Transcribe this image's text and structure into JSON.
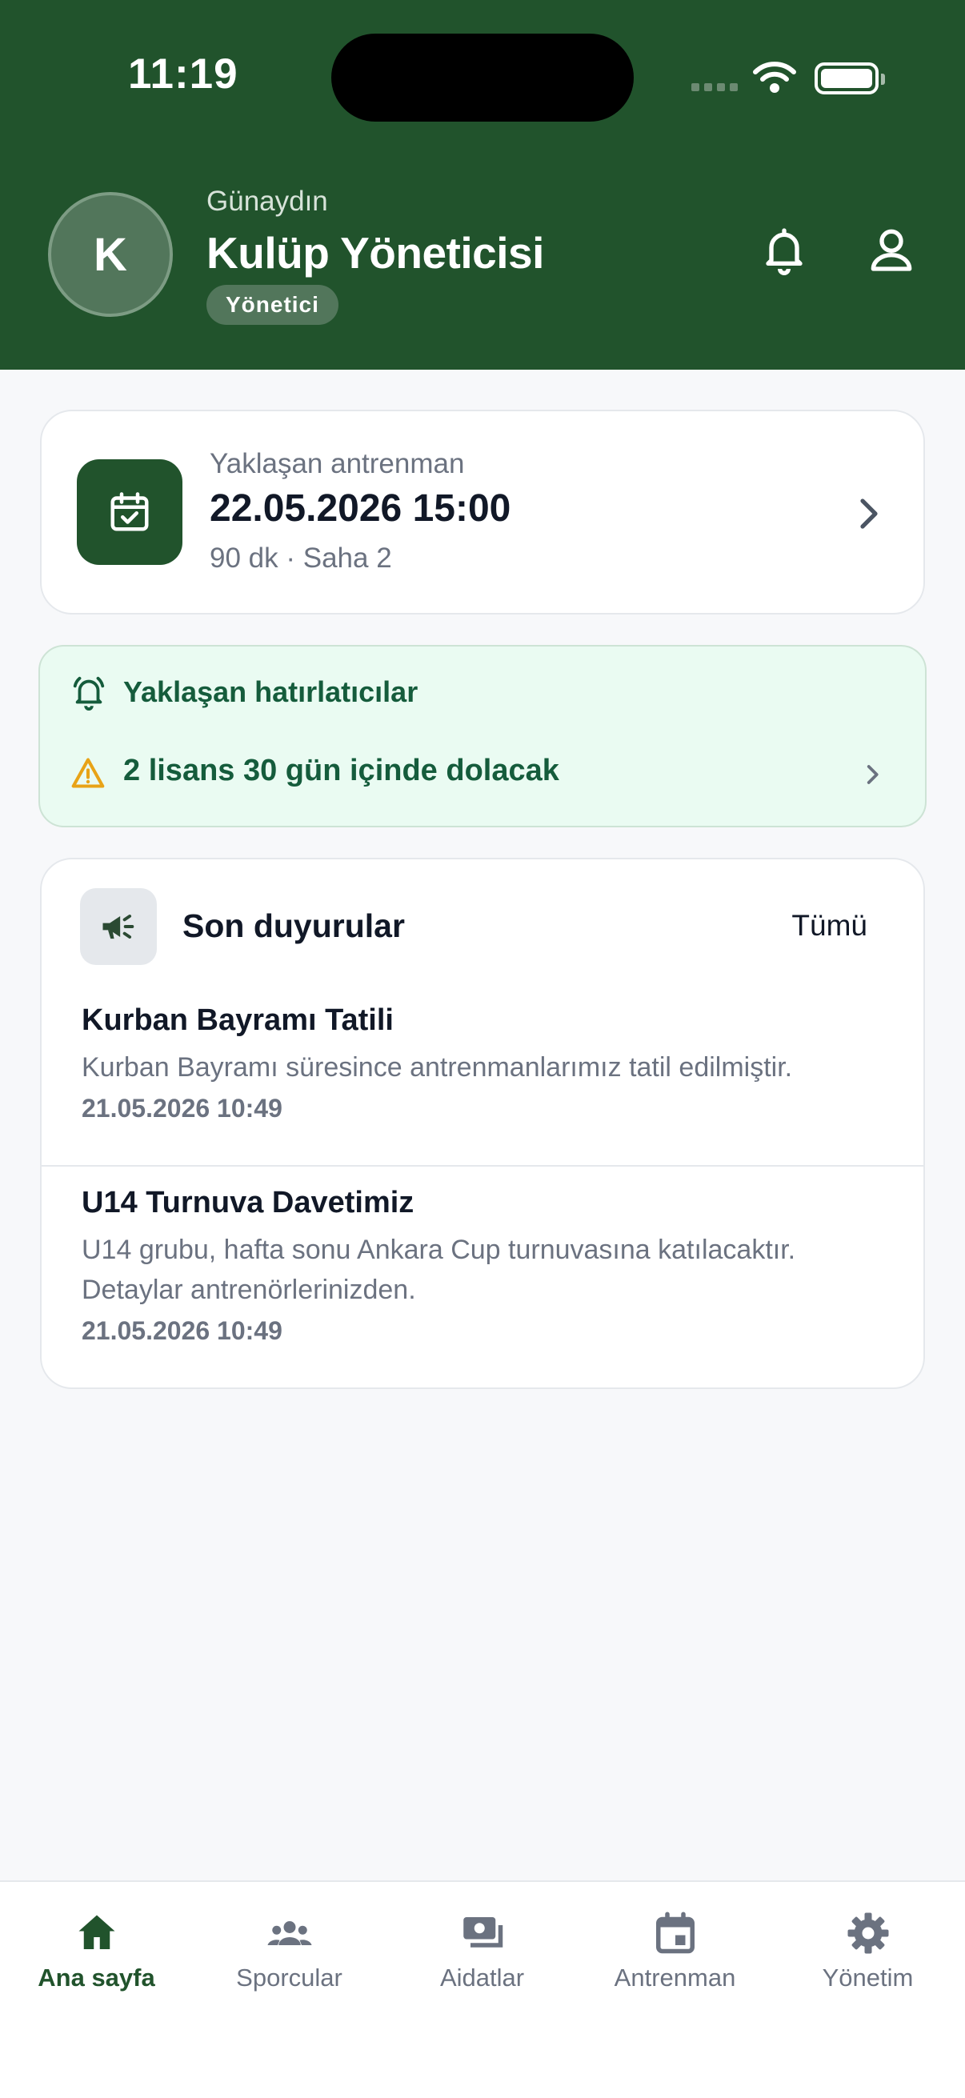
{
  "status_bar": {
    "time": "11:19"
  },
  "header": {
    "avatar_initial": "K",
    "greeting": "Günaydın",
    "user_name": "Kulüp Yöneticisi",
    "role": "Yönetici",
    "icons": [
      "bell-icon",
      "profile-icon"
    ]
  },
  "training": {
    "label": "Yaklaşan antrenman",
    "datetime": "22.05.2026 15:00",
    "meta": "90 dk · Saha 2"
  },
  "reminders": {
    "title": "Yaklaşan hatırlatıcılar",
    "items": [
      {
        "text": "2 lisans 30 gün içinde dolacak"
      }
    ]
  },
  "announcements": {
    "title": "Son duyurular",
    "all_label": "Tümü",
    "items": [
      {
        "title": "Kurban Bayramı Tatili",
        "body": "Kurban Bayramı süresince antrenmanlarımız tatil edilmiştir.",
        "date": "21.05.2026 10:49"
      },
      {
        "title": "U14 Turnuva Davetimiz",
        "body": "U14 grubu, hafta sonu Ankara Cup turnuvasına katılacaktır. Detaylar antrenörlerinizden.",
        "date": "21.05.2026 10:49"
      }
    ]
  },
  "nav": {
    "items": [
      {
        "label": "Ana sayfa",
        "icon": "home-icon",
        "active": true
      },
      {
        "label": "Sporcular",
        "icon": "people-icon",
        "active": false
      },
      {
        "label": "Aidatlar",
        "icon": "payments-icon",
        "active": false
      },
      {
        "label": "Antrenman",
        "icon": "calendar-icon",
        "active": false
      },
      {
        "label": "Yönetim",
        "icon": "settings-icon",
        "active": false
      }
    ]
  },
  "colors": {
    "primary": "#21532c",
    "reminder_bg": "#eafbf2",
    "reminder_text": "#155c3c",
    "warning": "#e8a317",
    "muted_text": "#6b7280"
  }
}
